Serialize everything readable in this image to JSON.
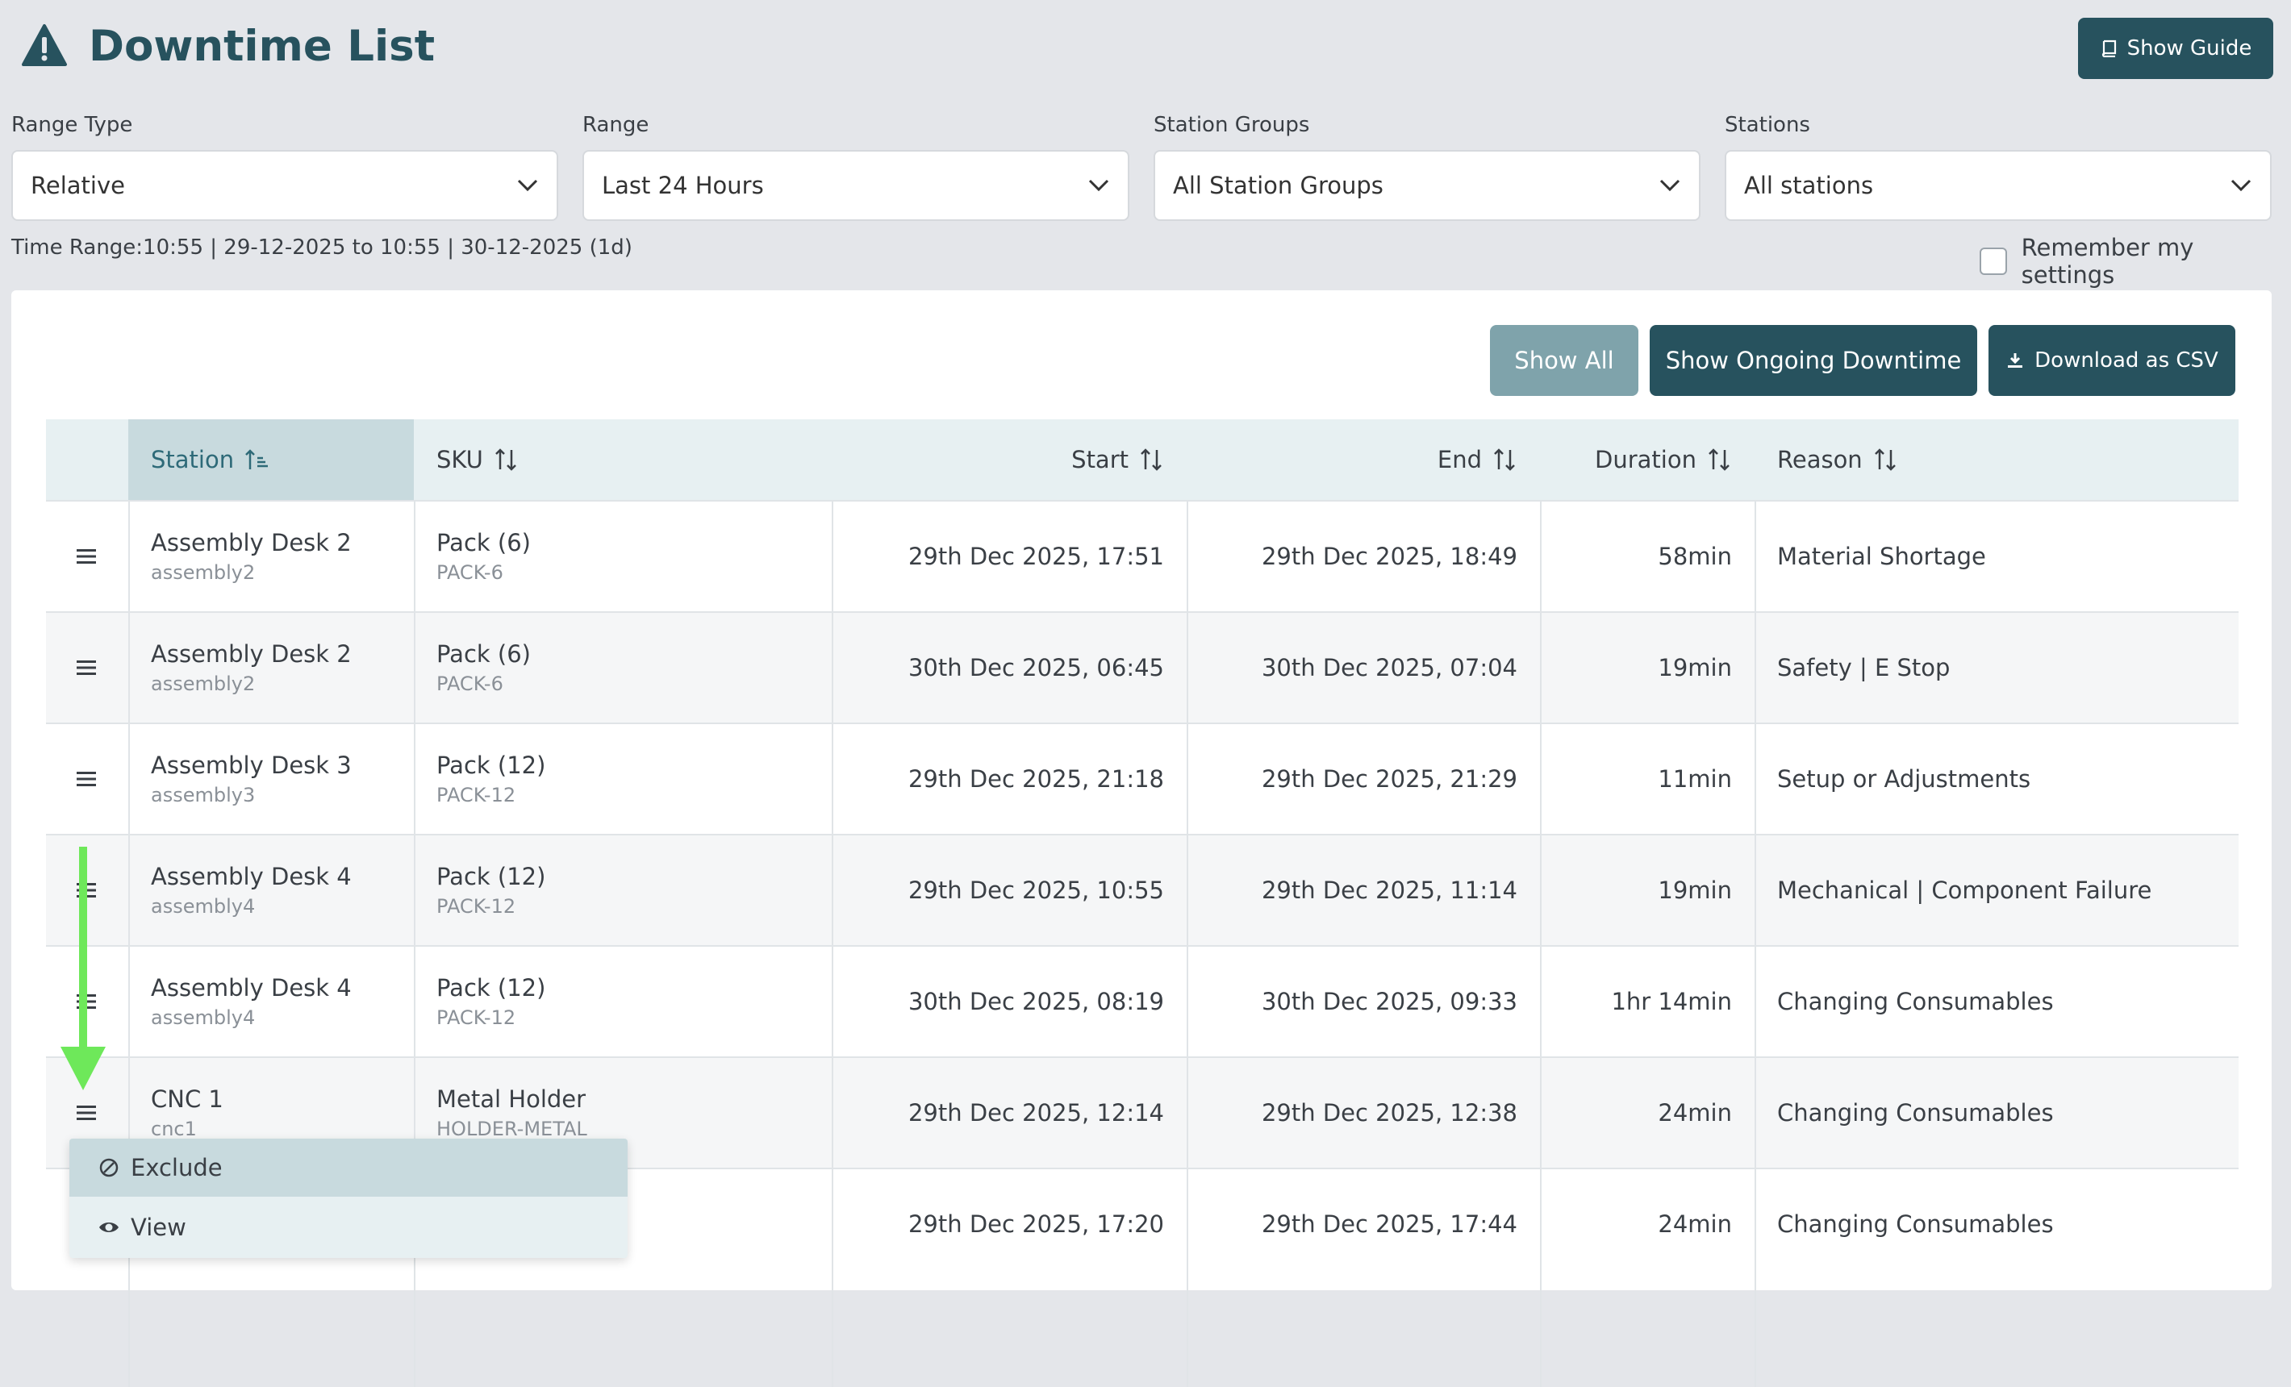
{
  "header": {
    "title": "Downtime List",
    "guide_label": "Show Guide",
    "icons": {
      "title": "warning-triangle-icon",
      "guide": "book-icon"
    }
  },
  "filters": {
    "range_type": {
      "label": "Range Type",
      "value": "Relative"
    },
    "range": {
      "label": "Range",
      "value": "Last 24 Hours"
    },
    "station_groups": {
      "label": "Station Groups",
      "value": "All Station Groups"
    },
    "stations": {
      "label": "Stations",
      "value": "All stations"
    },
    "time_range": "Time Range:10:55 | 29-12-2025 to 10:55 | 30-12-2025 (1d)",
    "remember_label": "Remember my settings",
    "remember_checked": false
  },
  "actions": {
    "show_all": "Show All",
    "show_ongoing": "Show Ongoing Downtime",
    "download_csv": "Download as CSV"
  },
  "table": {
    "columns": [
      "Station",
      "SKU",
      "Start",
      "End",
      "Duration",
      "Reason"
    ],
    "rows": [
      {
        "station": "Assembly Desk 2",
        "station_id": "assembly2",
        "sku": "Pack (6)",
        "sku_code": "PACK-6",
        "start": "29th Dec 2025, 17:51",
        "end": "29th Dec 2025, 18:49",
        "duration": "58min",
        "reason": "Material Shortage"
      },
      {
        "station": "Assembly Desk 2",
        "station_id": "assembly2",
        "sku": "Pack (6)",
        "sku_code": "PACK-6",
        "start": "30th Dec 2025, 06:45",
        "end": "30th Dec 2025, 07:04",
        "duration": "19min",
        "reason": "Safety | E Stop"
      },
      {
        "station": "Assembly Desk 3",
        "station_id": "assembly3",
        "sku": "Pack (12)",
        "sku_code": "PACK-12",
        "start": "29th Dec 2025, 21:18",
        "end": "29th Dec 2025, 21:29",
        "duration": "11min",
        "reason": "Setup or Adjustments"
      },
      {
        "station": "Assembly Desk 4",
        "station_id": "assembly4",
        "sku": "Pack (12)",
        "sku_code": "PACK-12",
        "start": "29th Dec 2025, 10:55",
        "end": "29th Dec 2025, 11:14",
        "duration": "19min",
        "reason": "Mechanical | Component Failure"
      },
      {
        "station": "Assembly Desk 4",
        "station_id": "assembly4",
        "sku": "Pack (12)",
        "sku_code": "PACK-12",
        "start": "30th Dec 2025, 08:19",
        "end": "30th Dec 2025, 09:33",
        "duration": "1hr 14min",
        "reason": "Changing Consumables"
      },
      {
        "station": "CNC 1",
        "station_id": "cnc1",
        "sku": "Metal Holder",
        "sku_code": "HOLDER-METAL",
        "start": "29th Dec 2025, 12:14",
        "end": "29th Dec 2025, 12:38",
        "duration": "24min",
        "reason": "Changing Consumables"
      },
      {
        "station": "",
        "station_id": "",
        "sku": "",
        "sku_code": "",
        "start": "29th Dec 2025, 17:20",
        "end": "29th Dec 2025, 17:44",
        "duration": "24min",
        "reason": "Changing Consumables"
      }
    ]
  },
  "row_menu": {
    "items": [
      {
        "label": "Exclude",
        "icon": "ban-icon"
      },
      {
        "label": "View",
        "icon": "eye-icon"
      }
    ]
  },
  "colors": {
    "primary": "#27525e",
    "muted_button": "#7fa3ab",
    "header_bg": "#e7f0f2",
    "sorted_header_bg": "#c8dade",
    "annotation_arrow": "#6ee85a"
  }
}
